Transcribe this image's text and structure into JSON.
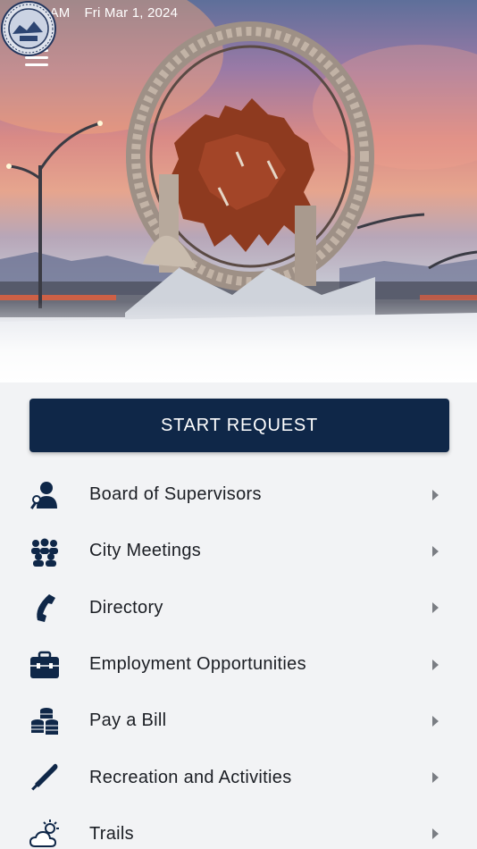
{
  "status_bar": {
    "time": "8:05 AM",
    "date": "Fri Mar 1, 2024"
  },
  "header": {
    "menu_icon": "hamburger-menu-icon",
    "seal_icon": "city-seal-icon"
  },
  "start_request": {
    "label": "START REQUEST"
  },
  "menu": {
    "items": [
      {
        "label": "Board of Supervisors",
        "icon": "supervisor-icon"
      },
      {
        "label": "City Meetings",
        "icon": "group-icon"
      },
      {
        "label": "Directory",
        "icon": "phone-icon"
      },
      {
        "label": "Employment Opportunities",
        "icon": "briefcase-icon"
      },
      {
        "label": "Pay a Bill",
        "icon": "coins-icon"
      },
      {
        "label": "Recreation and Activities",
        "icon": "baseball-bat-icon"
      },
      {
        "label": "Trails",
        "icon": "weather-cloud-sun-icon"
      }
    ]
  },
  "colors": {
    "primary": "#0f2748",
    "background": "#f2f3f5",
    "text": "#1b1e24",
    "chevron": "#7a7d83"
  }
}
